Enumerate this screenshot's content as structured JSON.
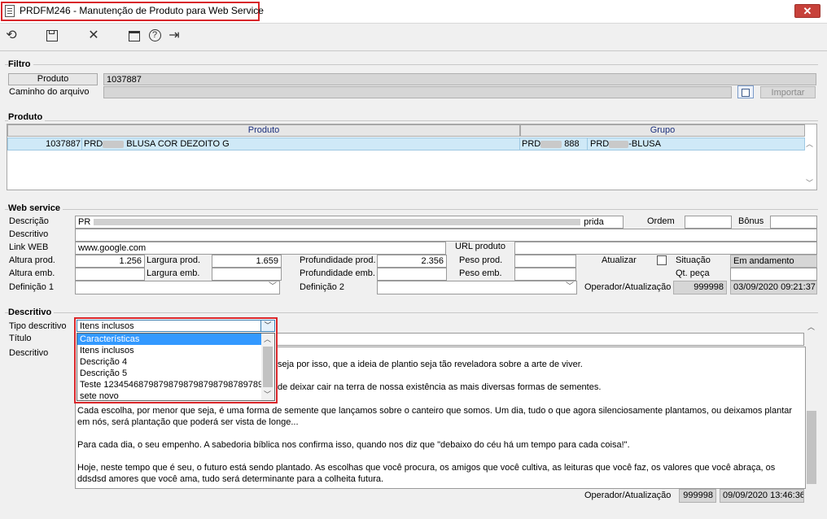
{
  "window": {
    "title": "PRDFM246 - Manutenção de Produto para Web Service",
    "close_label": "✕"
  },
  "toolbar": {
    "icons": [
      "undo-icon",
      "save-icon",
      "cancel-icon",
      "calendar-icon",
      "help-icon",
      "exit-icon"
    ],
    "undo": "⟲",
    "save": "💾",
    "cancel": "✕",
    "calendar": "📅",
    "help": "?",
    "exit": "⇥"
  },
  "filtro": {
    "title": "Filtro",
    "produto_label": "Produto",
    "produto_value": "1037887",
    "caminho_label": "Caminho do arquivo",
    "caminho_value": "",
    "importar_label": "Importar"
  },
  "produto": {
    "title": "Produto",
    "columns": [
      "Produto",
      "Grupo"
    ],
    "row": {
      "codigo": "1037887",
      "descricao_prefix": "PRD",
      "descricao_suffix": "BLUSA COR DEZOITO G",
      "grupo_prefix": "PRD",
      "grupo_num": "888",
      "grupo_desc_prefix": "PRD",
      "grupo_desc_suffix": "-BLUSA"
    }
  },
  "webservice": {
    "title": "Web service",
    "descricao_label": "Descrição",
    "descricao_value_prefix": "PR",
    "descricao_value_suffix": "prida",
    "descritivo_label": "Descritivo",
    "link_label": "Link WEB",
    "link_value": "www.google.com",
    "url_produto_label": "URL produto",
    "ordem_label": "Ordem",
    "bonus_label": "Bônus",
    "altura_prod_label": "Altura prod.",
    "altura_prod_value": "1.256",
    "largura_prod_label": "Largura prod.",
    "largura_prod_value": "1.659",
    "profundidade_prod_label": "Profundidade prod.",
    "profundidade_prod_value": "2.356",
    "peso_prod_label": "Peso prod.",
    "altura_emb_label": "Altura emb.",
    "largura_emb_label": "Largura emb.",
    "profundidade_emb_label": "Profundidade emb.",
    "peso_emb_label": "Peso emb.",
    "atualizar_label": "Atualizar",
    "situacao_label": "Situação",
    "situacao_value": "Em andamento",
    "qt_peca_label": "Qt. peça",
    "definicao1_label": "Definição 1",
    "definicao2_label": "Definição 2",
    "operador_label": "Operador/Atualização",
    "operador_value": "999998",
    "atualizacao_value": "03/09/2020 09:21:37"
  },
  "descritivo": {
    "title": "Descritivo",
    "tipo_label": "Tipo descritivo",
    "tipo_value": "Itens inclusos",
    "titulo_label": "Título",
    "descritivo_label": "Descritivo",
    "options": [
      "Características",
      "Itens inclusos",
      "Descrição 4",
      "Descrição 5",
      "Teste  12345468798798798798798798789789",
      "sete novo"
    ],
    "text_line1": "seja por isso, que a ideia de plantio seja tão reveladora sobre a arte de viver.",
    "text_line2": "de deixar cair na terra de nossa existência as mais diversas formas de sementes.",
    "text_para3": "Cada escolha, por menor que seja, é uma forma de semente que lançamos sobre o canteiro que somos. Um dia, tudo o que agora silenciosamente plantamos, ou deixamos plantar em nós, será plantação que poderá ser vista de longe...",
    "text_para4": "Para cada dia, o seu empenho. A sabedoria bíblica nos confirma isso, quando nos diz que \"debaixo do céu há um tempo para cada coisa!\".",
    "text_para5": "Hoje, neste tempo que é seu, o futuro está sendo plantado. As escolhas que você procura, os amigos que você cultiva, as leituras que você faz, os valores que você abraça, os ddsdsd amores que você ama, tudo será determinante para a colheita futura.",
    "operador_label": "Operador/Atualização",
    "operador_value": "999998",
    "atualizacao_value": "09/09/2020 13:46:36"
  }
}
